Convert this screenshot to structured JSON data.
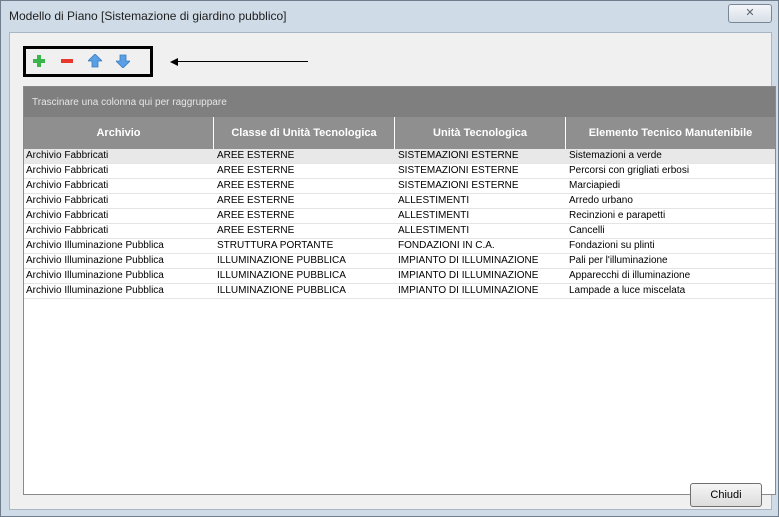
{
  "window": {
    "title": "Modello di Piano [Sistemazione di giardino pubblico]",
    "close_glyph": "✕"
  },
  "toolbar": {
    "icons": [
      "plus-icon",
      "minus-icon",
      "arrow-up-icon",
      "arrow-down-icon"
    ],
    "colors": {
      "plus": "#3ab54a",
      "minus": "#e8372b",
      "arrows": "#5aa0e6"
    }
  },
  "grid": {
    "group_hint": "Trascinare una colonna qui per raggruppare",
    "columns": [
      "Archivio",
      "Classe di Unità Tecnologica",
      "Unità Tecnologica",
      "Elemento Tecnico Manutenibile"
    ],
    "rows": [
      [
        "Archivio Fabbricati",
        "AREE ESTERNE",
        "SISTEMAZIONI ESTERNE",
        "Sistemazioni a verde"
      ],
      [
        "Archivio Fabbricati",
        "AREE ESTERNE",
        "SISTEMAZIONI ESTERNE",
        "Percorsi con grigliati erbosi"
      ],
      [
        "Archivio Fabbricati",
        "AREE ESTERNE",
        "SISTEMAZIONI ESTERNE",
        "Marciapiedi"
      ],
      [
        "Archivio Fabbricati",
        "AREE ESTERNE",
        "ALLESTIMENTI",
        "Arredo urbano"
      ],
      [
        "Archivio Fabbricati",
        "AREE ESTERNE",
        "ALLESTIMENTI",
        "Recinzioni e parapetti"
      ],
      [
        "Archivio Fabbricati",
        "AREE ESTERNE",
        "ALLESTIMENTI",
        "Cancelli"
      ],
      [
        "Archivio Illuminazione Pubblica",
        "STRUTTURA PORTANTE",
        "FONDAZIONI IN C.A.",
        "Fondazioni su plinti"
      ],
      [
        "Archivio Illuminazione Pubblica",
        "ILLUMINAZIONE PUBBLICA",
        "IMPIANTO DI ILLUMINAZIONE",
        "Pali per l'illuminazione"
      ],
      [
        "Archivio Illuminazione Pubblica",
        "ILLUMINAZIONE PUBBLICA",
        "IMPIANTO DI ILLUMINAZIONE",
        "Apparecchi di illuminazione"
      ],
      [
        "Archivio Illuminazione Pubblica",
        "ILLUMINAZIONE PUBBLICA",
        "IMPIANTO DI ILLUMINAZIONE",
        "Lampade a luce miscelata"
      ]
    ]
  },
  "footer": {
    "close_label": "Chiudi"
  }
}
